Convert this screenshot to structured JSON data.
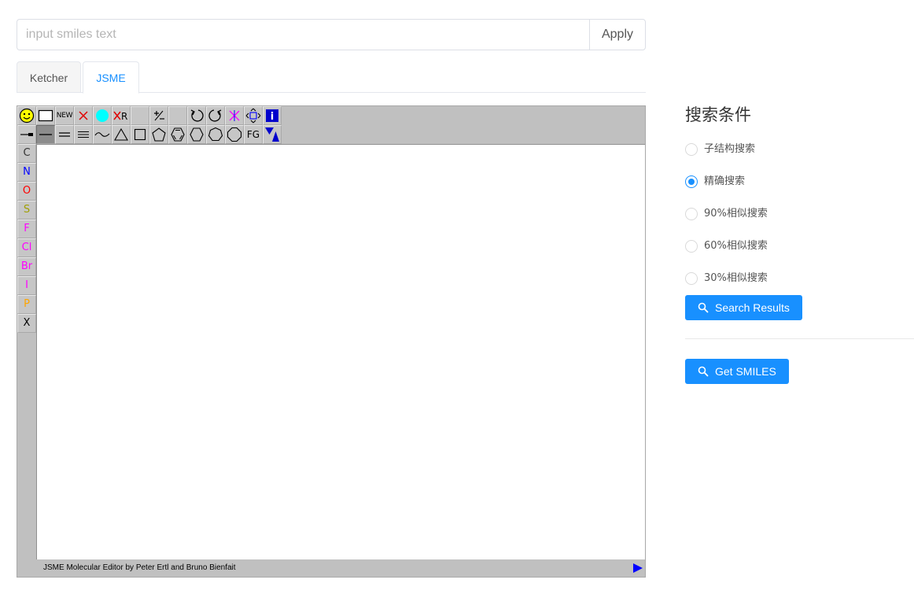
{
  "search": {
    "placeholder": "input smiles text",
    "value": "",
    "apply_label": "Apply"
  },
  "tabs": [
    {
      "label": "Ketcher",
      "active": false
    },
    {
      "label": "JSME",
      "active": true
    }
  ],
  "jsme": {
    "toolbar_row1": [
      "smiley-icon",
      "clear-rect-icon",
      "NEW",
      "delete-x-icon",
      "cyan-dot-icon",
      "delete-r-icon",
      "",
      "charge-icon",
      "",
      "undo-icon",
      "redo-icon",
      "delete-group-icon",
      "move-icon",
      "info-icon"
    ],
    "toolbar_row2": [
      "chain-icon",
      "single-bond-icon",
      "double-bond-icon",
      "triple-bond-icon",
      "wave-bond-icon",
      "ring3-icon",
      "ring4-icon",
      "ring5-icon",
      "benzene-icon",
      "ring6-icon",
      "ring7-icon",
      "ring8-icon",
      "FG",
      "stereo-icon"
    ],
    "new_label": "NEW",
    "fg_label": "FG",
    "atoms": [
      {
        "symbol": "C",
        "color": "#333333"
      },
      {
        "symbol": "N",
        "color": "#0000ff"
      },
      {
        "symbol": "O",
        "color": "#ff0000"
      },
      {
        "symbol": "S",
        "color": "#a0a000"
      },
      {
        "symbol": "F",
        "color": "#ff00ff"
      },
      {
        "symbol": "Cl",
        "color": "#ff00ff"
      },
      {
        "symbol": "Br",
        "color": "#ff00ff"
      },
      {
        "symbol": "I",
        "color": "#ff00ff"
      },
      {
        "symbol": "P",
        "color": "#ffa500"
      },
      {
        "symbol": "X",
        "color": "#000000"
      }
    ],
    "footer": "JSME Molecular Editor by Peter Ertl and Bruno Bienfait"
  },
  "panel": {
    "title": "搜索条件",
    "options": [
      {
        "label": "子结构搜索",
        "checked": false
      },
      {
        "label": "精确搜索",
        "checked": true
      },
      {
        "label": "90%相似搜索",
        "checked": false
      },
      {
        "label": "60%相似搜索",
        "checked": false
      },
      {
        "label": "30%相似搜索",
        "checked": false
      }
    ],
    "search_button": "Search Results",
    "smiles_button": "Get SMILES"
  },
  "colors": {
    "primary": "#1890ff",
    "jsme_gray": "#c0c0c0"
  }
}
